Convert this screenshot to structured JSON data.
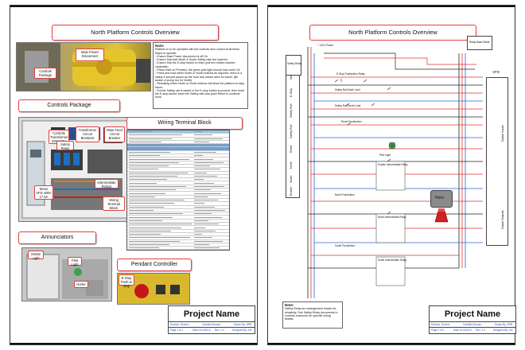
{
  "sheet1": {
    "title": "North Platform Controls Overview",
    "photo1_callouts": {
      "main_power": "Main Power Disconnect",
      "controls_package": "Controls Package"
    },
    "note": {
      "heading": "Note:",
      "lines": [
        "Platform is to be operated with the controls door closed at all times.",
        "Steps to operate:",
        "- Ensure Main Power disconnect is off On",
        "- Ensure that both North & South Safety rails are lowered",
        "- Ensure that the E-stop button is reset (pull turn button counter-clockwise)",
        "- Press reset on Pendant, the green pilot light should now come On",
        "- Press and hold either North or South buttons as required, there is a safety 5 second pause as the horn and strobe warn for travel. (Be aware of pump run for North)",
        "- Releasing either North or South buttons will allow the platform to stay travel.",
        "- Further Safety rail is raised or the E-stop button is pushed, then reset the E-stop and/or lower the Safety rails and push Reset to continue work."
      ]
    },
    "controls_package_label": "Controls Package",
    "controls_callouts": {
      "transformer": "Controls Transformer 480/120V",
      "breakers": "Transformer Circuit Breakers",
      "main_cb": "Main Feed Circuit Breaker",
      "safety_relay": "Safety Relay",
      "intermediate": "Intermediate Relays",
      "motor_vfd": "Motor VFD 480V 17.5A",
      "wiring_block": "Wiring Terminal Block"
    },
    "wiring_label": "Wiring Terminal Block",
    "annunciators_label": "Annunciators",
    "annunciator_callouts": {
      "strobe": "Strobe Light",
      "pilot": "Pilot Light",
      "horn": "Horter"
    },
    "pendant_label": "Pendant Controller",
    "pendant_callout": "E-Stop Push to Stop",
    "project": {
      "name": "Project Name",
      "row1": [
        "Division: Service",
        "Carlotta Duncan",
        "Drawn By: NPB"
      ],
      "row2": [
        "Page 1 of 1",
        "Date: 6/13/2013",
        "Rev: 1.0",
        "Designed By: xxx"
      ]
    }
  },
  "sheet2": {
    "title": "North Platform Controls Overview",
    "relay_box": "Relay Base Detail",
    "vfd_label": "VFD",
    "safety_relay": "Safety Relay",
    "pilot_light": "Pilot Light",
    "horn": "Horn",
    "labels": {
      "top_supply": "+ 120V Power",
      "estop": "E-Stop Pushbutton Relay",
      "safety_rail_n": "Safety Rail North Limit",
      "safety_rail_s": "Safety Rail South Limit",
      "reset": "Reset Pushbutton",
      "south": "South Limit Switch",
      "north": "North Pushbutton",
      "south_pb": "South Pushbutton",
      "enable": "Enable Intermediate Relay",
      "n_relay": "North Intermediate Relay",
      "s_relay": "South Intermediate Relay"
    },
    "left_block": [
      "Safety Relay",
      "E-Stop",
      "Safety Rail",
      "Safety Rail",
      "Reset",
      "North",
      "South",
      "Enable"
    ],
    "vfd_block": [
      "Digital Inputs",
      "Digital Outputs"
    ],
    "note": {
      "heading": "Note:",
      "body": "Safety Relay are arrangement shown for simplicity. See Safety Relay documents in controls enclosure for specific wiring details."
    },
    "project": {
      "name": "Project Name",
      "row1": [
        "Division: Service",
        "Carlotta Duncan",
        "Drawn By: NPB"
      ],
      "row2": [
        "Page 2 of 2",
        "Date: 6/13/2013",
        "Rev: 1.0",
        "Designed By: xxx"
      ]
    }
  },
  "colors": {
    "callout_border": "#e04040",
    "wire_red": "#e03030",
    "wire_blue": "#3060d0",
    "wire_black": "#222222",
    "horn_gray": "#8a8a8a",
    "strobe_red": "#d42020",
    "table_header": "#9ec3e6",
    "title_blue": "#2a52be"
  }
}
